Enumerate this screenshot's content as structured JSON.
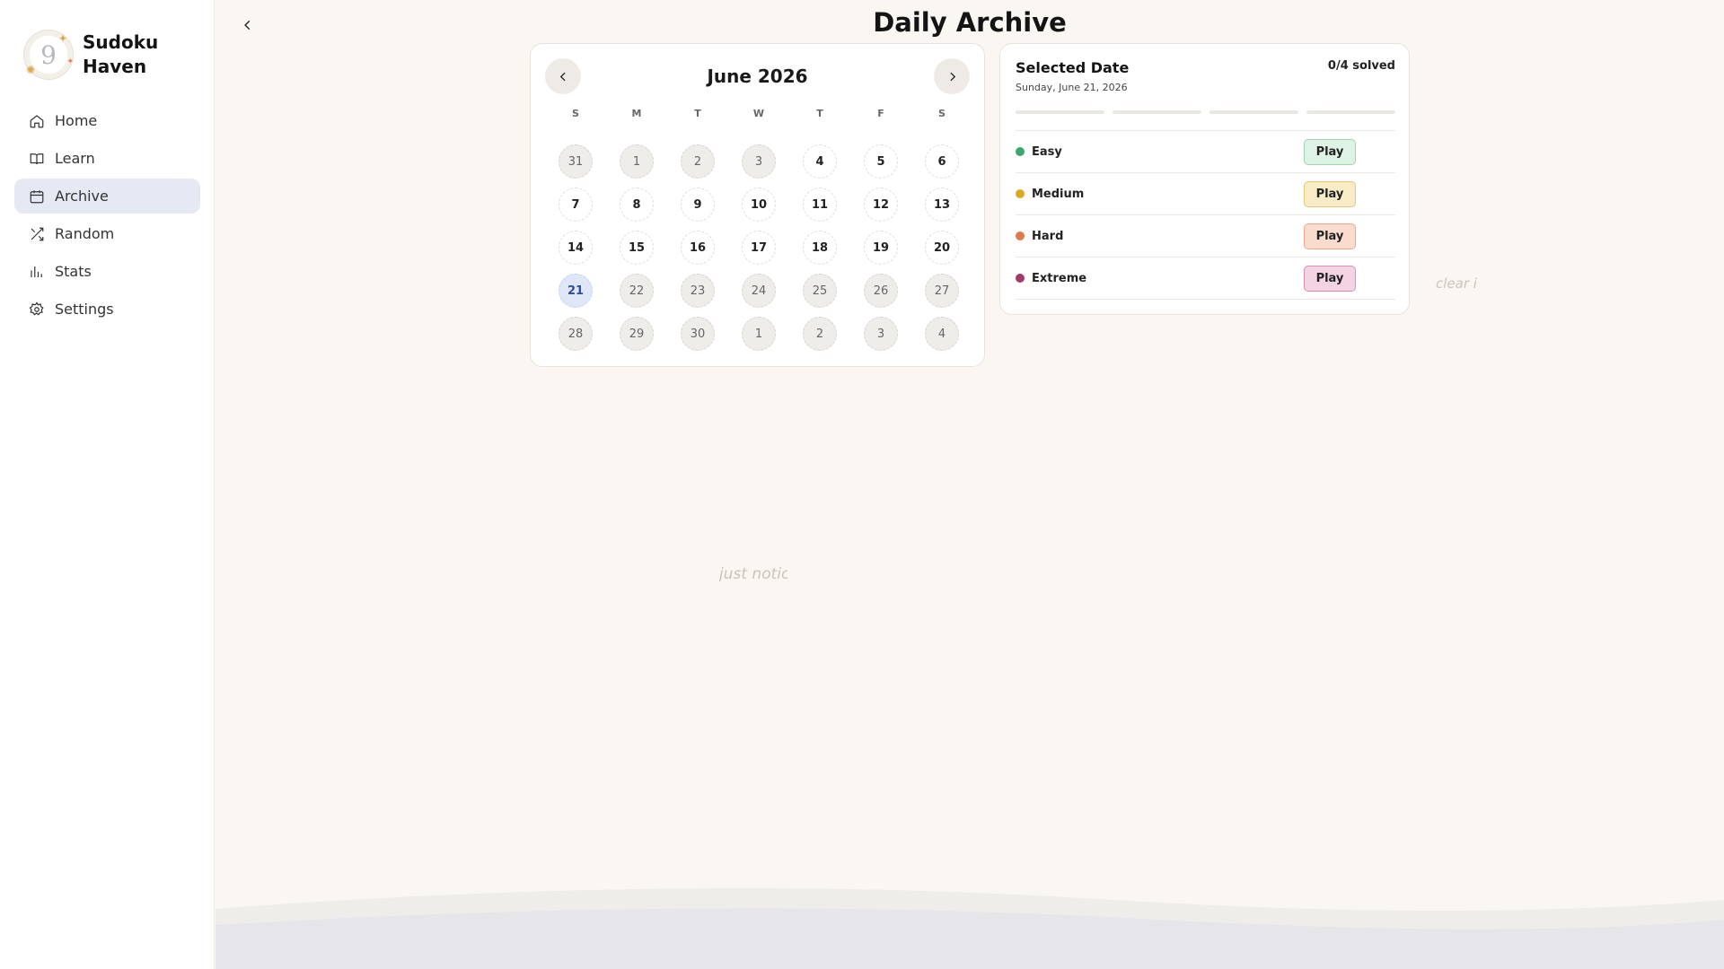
{
  "app": {
    "name": "Sudoku Haven"
  },
  "sidebar": {
    "items": [
      {
        "label": "Home",
        "icon": "home-icon"
      },
      {
        "label": "Learn",
        "icon": "book-icon"
      },
      {
        "label": "Archive",
        "icon": "calendar-icon",
        "active": true
      },
      {
        "label": "Random",
        "icon": "shuffle-icon"
      },
      {
        "label": "Stats",
        "icon": "bar-chart-icon"
      },
      {
        "label": "Settings",
        "icon": "gear-icon"
      }
    ]
  },
  "header": {
    "title": "Daily Archive",
    "back_icon": "chevron-left-icon"
  },
  "calendar": {
    "month_label": "June 2026",
    "prev_icon": "chevron-left-icon",
    "next_icon": "chevron-right-icon",
    "weekdays": [
      "S",
      "M",
      "T",
      "W",
      "T",
      "F",
      "S"
    ],
    "weeks": [
      [
        "31",
        "1",
        "2",
        "3",
        "4",
        "5",
        "6"
      ],
      [
        "7",
        "8",
        "9",
        "10",
        "11",
        "12",
        "13"
      ],
      [
        "14",
        "15",
        "16",
        "17",
        "18",
        "19",
        "20"
      ],
      [
        "21",
        "22",
        "23",
        "24",
        "25",
        "26",
        "27"
      ],
      [
        "28",
        "29",
        "30",
        "1",
        "2",
        "3",
        "4"
      ]
    ],
    "muted_days": [
      [
        0,
        0
      ],
      [
        0,
        1
      ],
      [
        0,
        2
      ],
      [
        0,
        3
      ],
      [
        3,
        1
      ],
      [
        3,
        2
      ],
      [
        3,
        3
      ],
      [
        3,
        4
      ],
      [
        3,
        5
      ],
      [
        3,
        6
      ],
      [
        4,
        0
      ],
      [
        4,
        1
      ],
      [
        4,
        2
      ],
      [
        4,
        3
      ],
      [
        4,
        4
      ],
      [
        4,
        5
      ],
      [
        4,
        6
      ]
    ],
    "selected_day": [
      3,
      0
    ]
  },
  "selected_date": {
    "title": "Selected Date",
    "date": "Sunday, June 21, 2026",
    "solved": "0/4 solved",
    "progress_segments": 4,
    "difficulties": [
      {
        "name": "Easy",
        "dot": "#3aa76d",
        "button": "Play",
        "bg": "#dff2e6",
        "border": "#9fd3b4"
      },
      {
        "name": "Medium",
        "dot": "#d9a920",
        "button": "Play",
        "bg": "#f8ecc6",
        "border": "#e3c877"
      },
      {
        "name": "Hard",
        "dot": "#e07a4a",
        "button": "Play",
        "bg": "#f9dccd",
        "border": "#e8a98a"
      },
      {
        "name": "Extreme",
        "dot": "#a4386a",
        "button": "Play",
        "bg": "#f4d3e3",
        "border": "#d890b4"
      }
    ]
  },
  "ghost_texts": [
    "clear i",
    "just notic"
  ],
  "colors": {
    "background": "#faf6f1",
    "active_nav": "#e4e9f3",
    "selected_day": "#dfe6f7"
  }
}
